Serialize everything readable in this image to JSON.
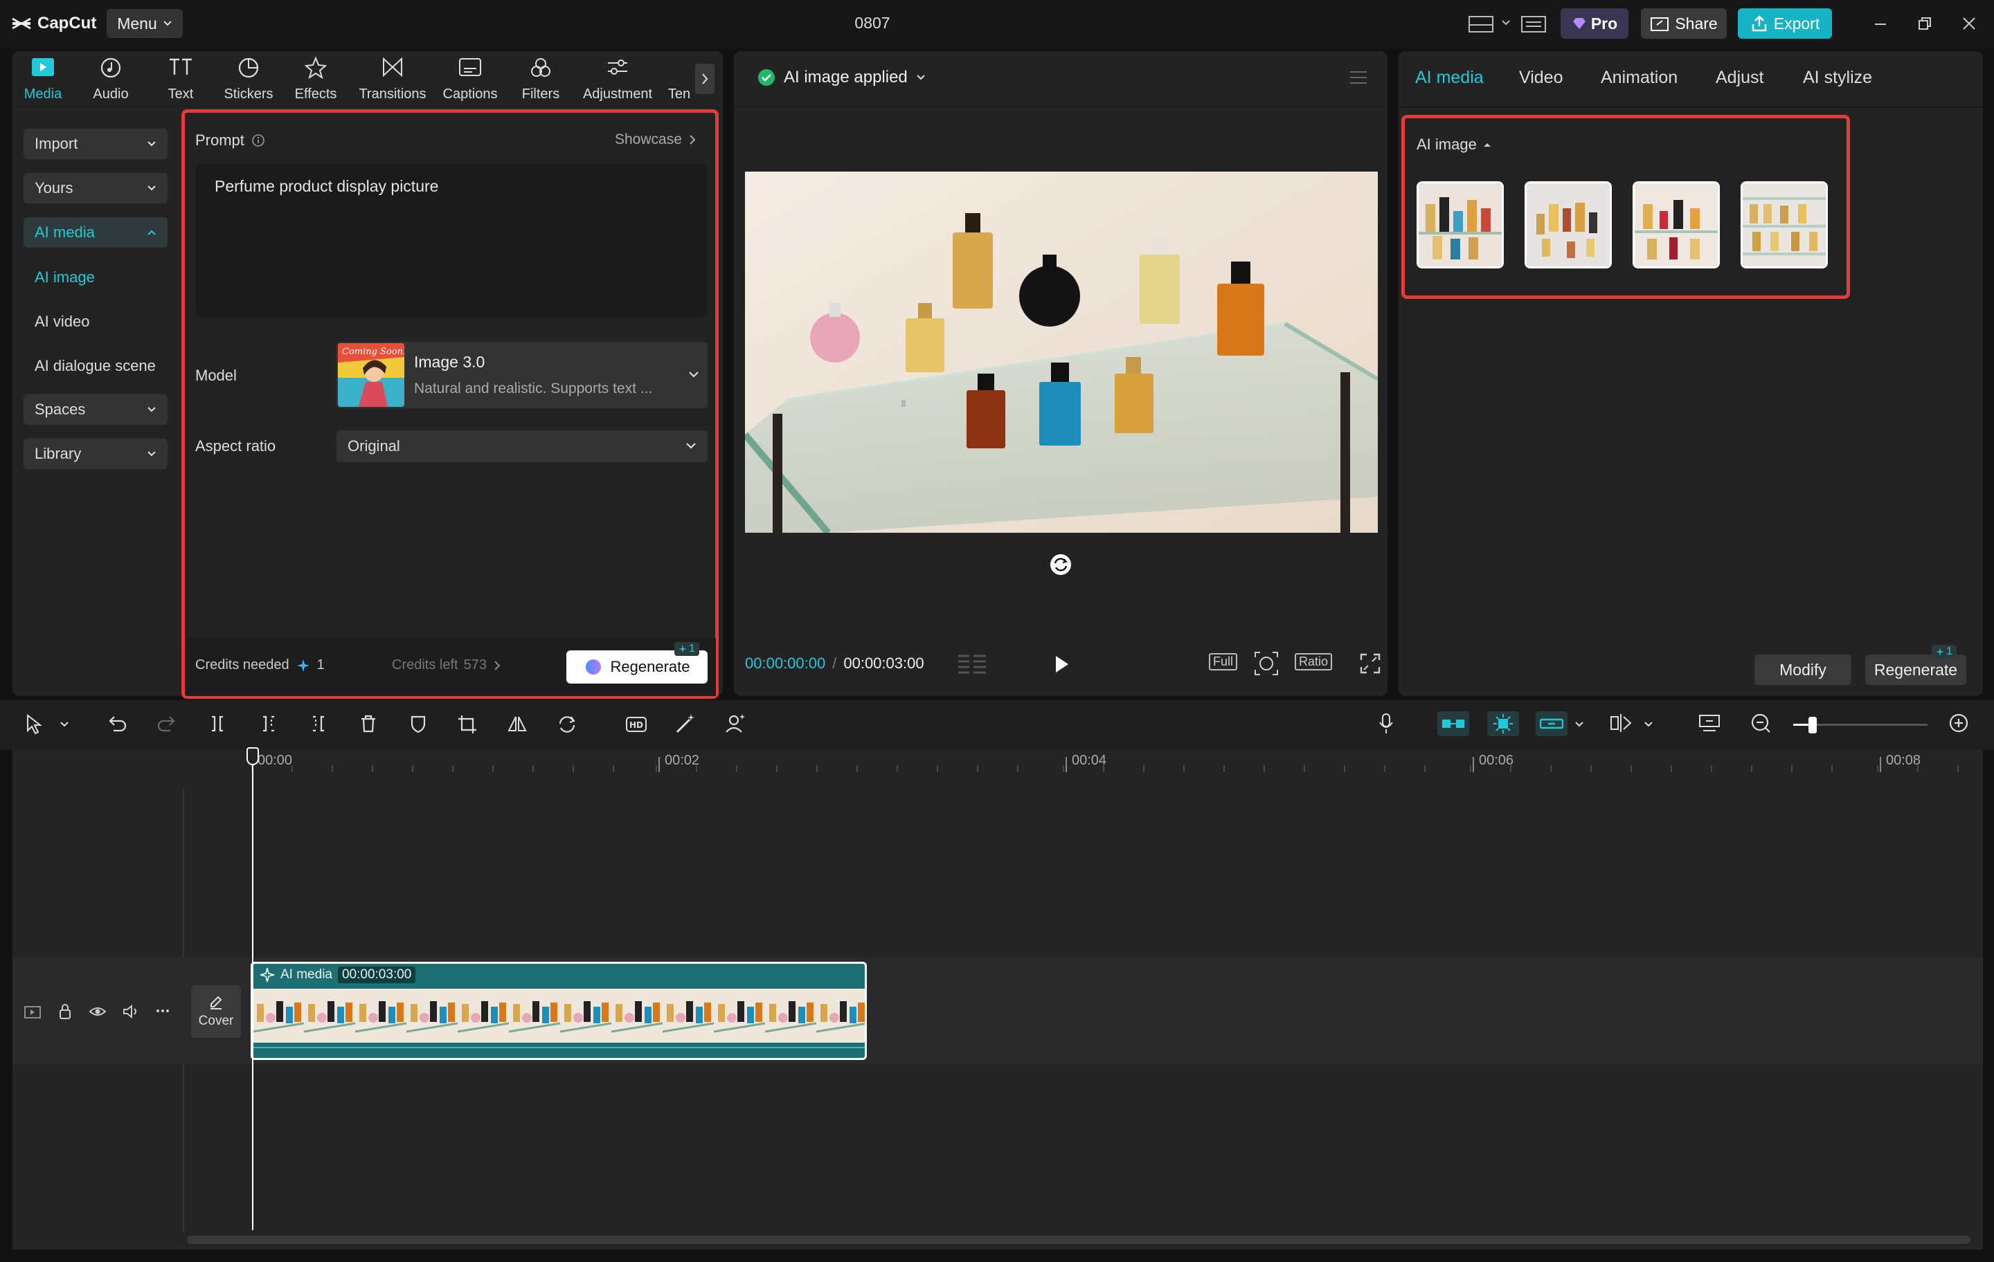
{
  "app": {
    "logo": "CapCut",
    "menu_label": "Menu",
    "doc_title": "0807",
    "pro_label": "Pro",
    "share_label": "Share",
    "export_label": "Export"
  },
  "toolbar": {
    "tabs": [
      "Media",
      "Audio",
      "Text",
      "Stickers",
      "Effects",
      "Transitions",
      "Captions",
      "Filters",
      "Adjustment",
      "Ten"
    ]
  },
  "nav": {
    "import": "Import",
    "yours": "Yours",
    "ai_media": "AI media",
    "ai_image": "AI image",
    "ai_video": "AI video",
    "ai_dialogue": "AI dialogue scene",
    "spaces": "Spaces",
    "library": "Library"
  },
  "prompt": {
    "label": "Prompt",
    "showcase": "Showcase",
    "text": "Perfume product display picture",
    "model_label": "Model",
    "model_name": "Image 3.0",
    "model_desc": "Natural and realistic. Supports text ...",
    "model_thumb_text": "Coming Soon!",
    "aspect_label": "Aspect ratio",
    "aspect_value": "Original",
    "credits_needed": "Credits needed",
    "credits_needed_value": "1",
    "credits_left": "Credits left",
    "credits_left_value": "573",
    "regenerate": "Regenerate",
    "badge": "1"
  },
  "preview": {
    "status": "AI image applied",
    "time_current": "00:00:00:00",
    "time_total": "00:00:03:00",
    "full": "Full",
    "ratio": "Ratio"
  },
  "right": {
    "tabs": [
      "AI media",
      "Video",
      "Animation",
      "Adjust",
      "AI stylize"
    ],
    "section": "AI image",
    "modify": "Modify",
    "regenerate": "Regenerate",
    "badge": "1"
  },
  "timeline": {
    "ticks": [
      "00:00",
      "00:02",
      "00:04",
      "00:06",
      "00:08"
    ],
    "clip_label": "AI media",
    "clip_time": "00:00:03:00",
    "cover": "Cover"
  },
  "colors": {
    "accent": "#22c9d9",
    "highlight": "#e23b3b",
    "clip": "#1c6e73"
  }
}
